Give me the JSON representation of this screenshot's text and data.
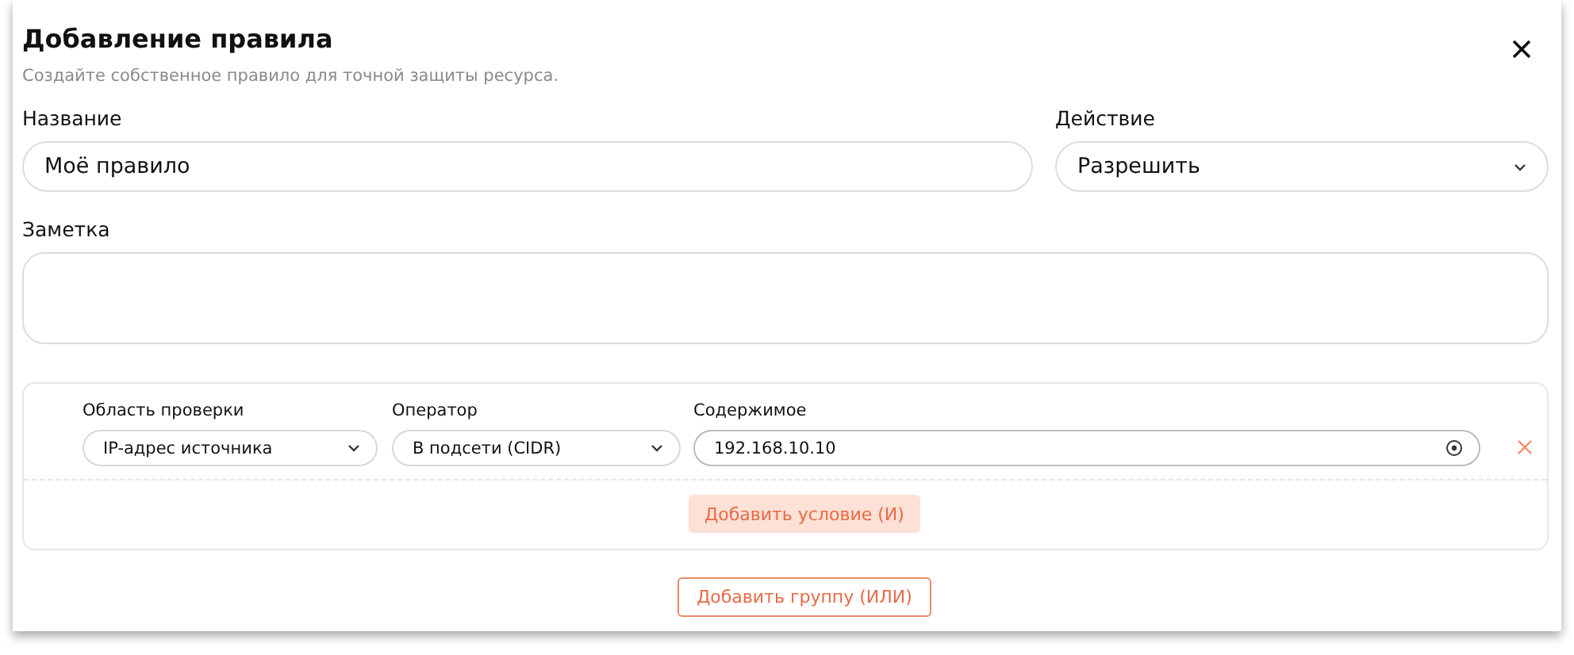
{
  "dialog": {
    "title": "Добавление правила",
    "subtitle": "Создайте собственное правило для точной защиты ресурса."
  },
  "name_field": {
    "label": "Название",
    "value": "Моё правило"
  },
  "action_field": {
    "label": "Действие",
    "value": "Разрешить"
  },
  "note_field": {
    "label": "Заметка"
  },
  "groups": [
    {
      "conditions": [
        {
          "scope": {
            "label": "Область проверки",
            "value": "IP-адрес источника"
          },
          "operator": {
            "label": "Оператор",
            "value": "В подсети (CIDR)"
          },
          "content": {
            "label": "Содержимое",
            "value": "192.168.10.10"
          }
        }
      ],
      "add_condition": "Добавить условие (И)"
    }
  ],
  "add_group": "Добавить группу (ИЛИ)"
}
